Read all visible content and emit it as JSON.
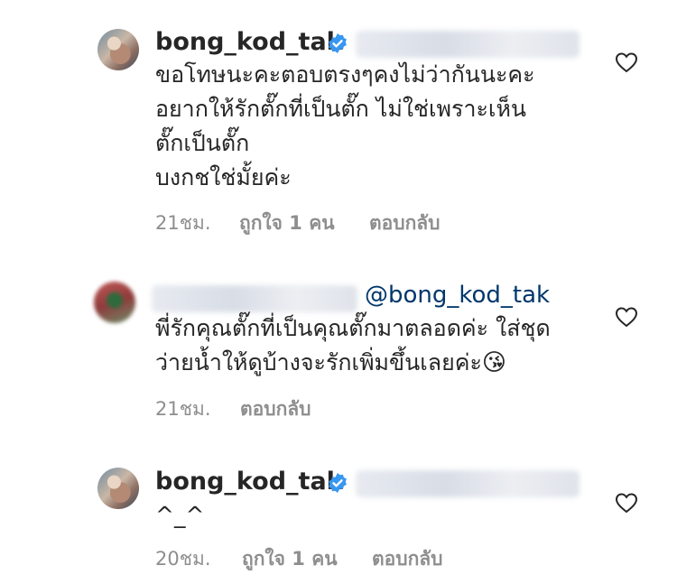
{
  "comments": [
    {
      "username": "bong_kod_tak",
      "text": "ขอโทษนะคะตอบตรงๆคงไม่ว่ากันนะคะ\nอยากให้รักตั๊กที่เป็นตั๊ก ไม่ใช่เพราะเห็น\nตั๊กเป็นตั๊ก\nบงกชใช่มั้ยค่ะ",
      "time": "21ชม.",
      "likes": "ถูกใจ 1 คน",
      "reply": "ตอบกลับ"
    },
    {
      "mention": "@bong_kod_tak",
      "text": "พี่รักคุณตั๊กที่เป็นคุณตั๊กมาตลอดค่ะ ใส่ชุด\nว่ายน้ำให้ดูบ้างจะรักเพิ่มขึ้นเลยค่ะ",
      "emoji": "😘",
      "time": "21ชม.",
      "reply": "ตอบกลับ"
    },
    {
      "username": "bong_kod_tak",
      "text": "^_^",
      "time": "20ชม.",
      "likes": "ถูกใจ 1 คน",
      "reply": "ตอบกลับ"
    }
  ],
  "colors": {
    "verified": "#3897f0",
    "mention": "#00376b",
    "meta": "#8e8e8e"
  },
  "icons": {
    "like": "heart-outline-icon",
    "verified": "verified-badge-icon"
  }
}
